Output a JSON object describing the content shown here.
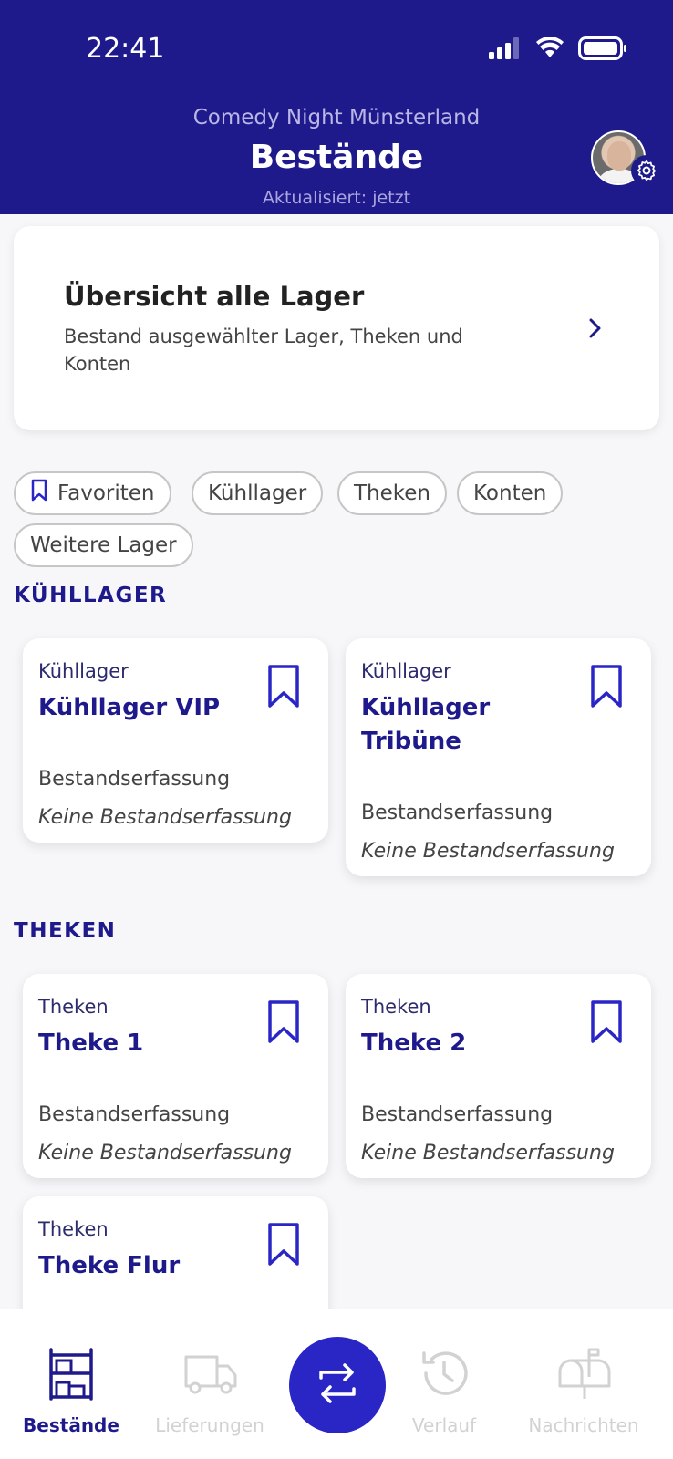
{
  "status_bar": {
    "time": "22:41"
  },
  "header": {
    "subtitle": "Comedy Night Münsterland",
    "title": "Bestände",
    "updated": "Aktualisiert: jetzt"
  },
  "overview": {
    "title": "Übersicht alle Lager",
    "description": "Bestand ausgewählter Lager, Theken und Konten"
  },
  "filters": {
    "favorites": "Favoriten",
    "kuehllager": "Kühllager",
    "theken": "Theken",
    "konten": "Konten",
    "weitere": "Weitere Lager"
  },
  "sections": {
    "kuehllager": {
      "title": "KÜHLLAGER",
      "cards": [
        {
          "category": "Kühllager",
          "name": "Kühllager VIP",
          "label": "Bestandserfassung",
          "value": "Keine Bestandserfassung"
        },
        {
          "category": "Kühllager",
          "name": "Kühllager Tribüne",
          "label": "Bestandserfassung",
          "value": "Keine Bestandserfassung"
        }
      ]
    },
    "theken": {
      "title": "THEKEN",
      "cards": [
        {
          "category": "Theken",
          "name": "Theke 1",
          "label": "Bestandserfassung",
          "value": "Keine Bestandserfassung"
        },
        {
          "category": "Theken",
          "name": "Theke 2",
          "label": "Bestandserfassung",
          "value": "Keine Bestandserfassung"
        },
        {
          "category": "Theken",
          "name": "Theke Flur"
        }
      ]
    }
  },
  "nav": {
    "bestaende": "Bestände",
    "lieferungen": "Lieferungen",
    "verlauf": "Verlauf",
    "nachrichten": "Nachrichten"
  },
  "colors": {
    "primary": "#1e1a8c",
    "fab": "#2a26c6",
    "inactive": "#d2d2d2"
  }
}
